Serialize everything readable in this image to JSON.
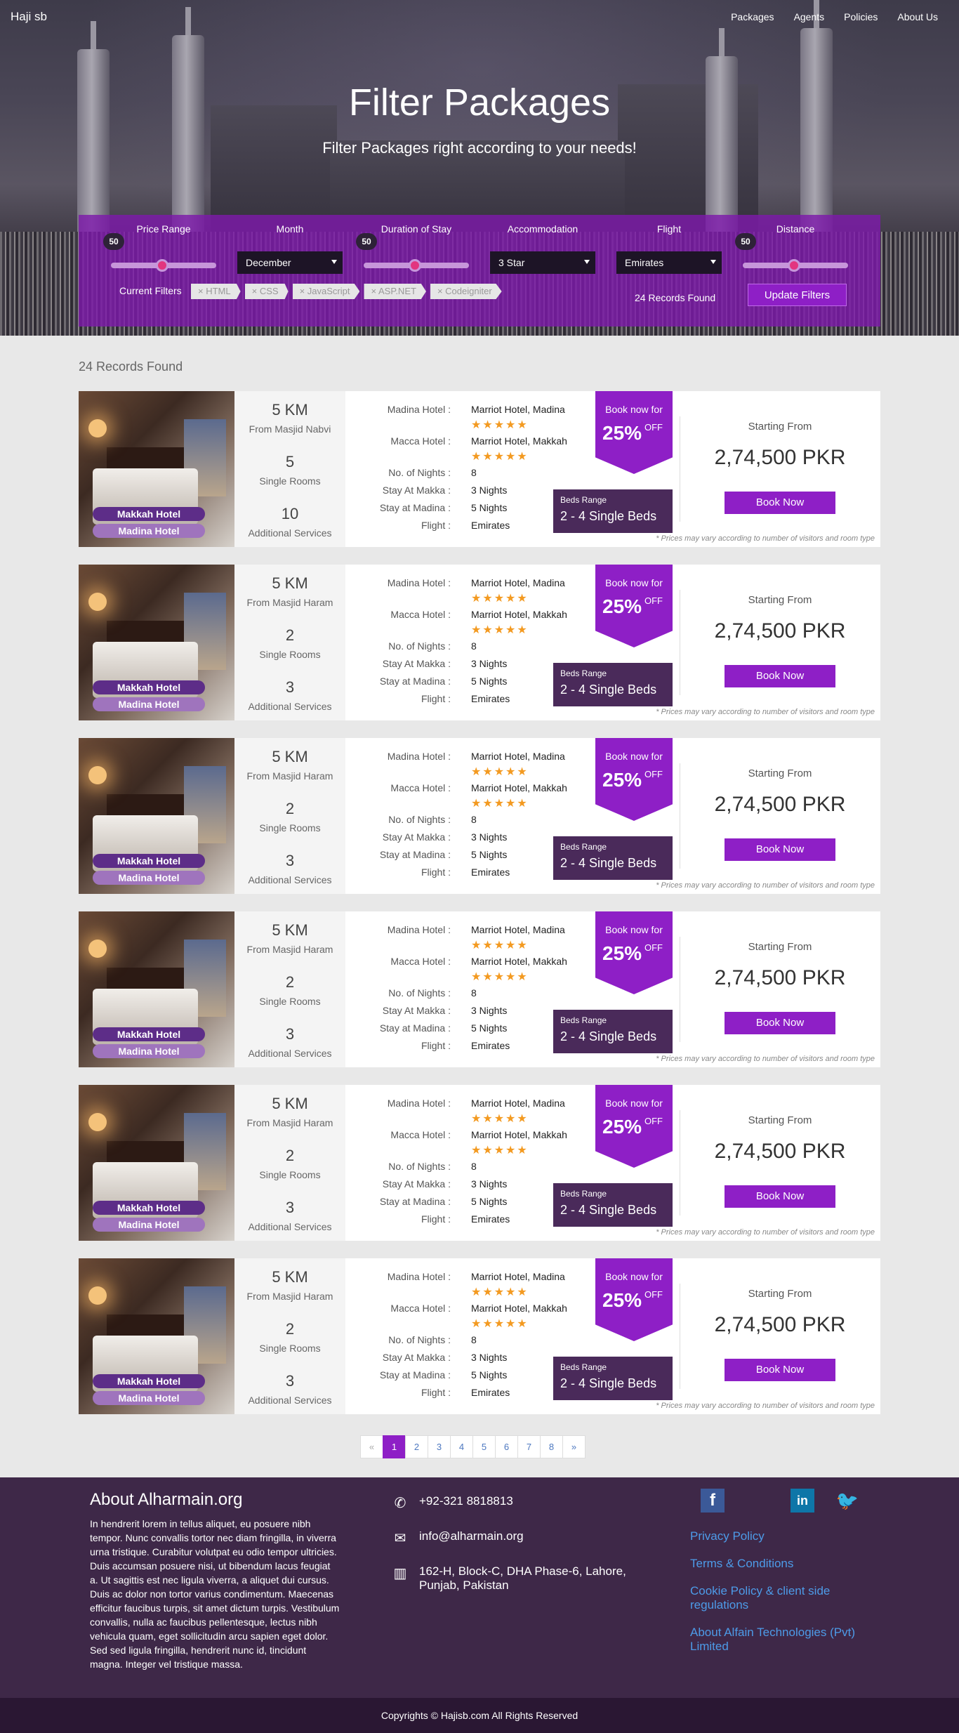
{
  "brand": "Haji sb",
  "nav": [
    "Packages",
    "Agents",
    "Policies",
    "About Us"
  ],
  "hero": {
    "title": "Filter Packages",
    "subtitle": "Filter Packages right according to your needs!"
  },
  "filters": {
    "labels": [
      "Price Range",
      "Month",
      "Duration of Stay",
      "Accommodation",
      "Flight",
      "Distance"
    ],
    "price_value": "50",
    "duration_value": "50",
    "distance_value": "50",
    "month": "December",
    "accommodation": "3 Star",
    "flight": "Emirates",
    "current_filters_label": "Current Filters",
    "tags": [
      "HTML",
      "CSS",
      "JavaScript",
      "ASP.NET",
      "Codeigniter"
    ],
    "records_found": "24 Records Found",
    "update_button": "Update Filters"
  },
  "records_heading": "24 Records Found",
  "card_labels": {
    "madina_hotel": "Madina Hotel :",
    "macca_hotel": "Macca Hotel :",
    "nights": "No. of Nights :",
    "stay_makka": "Stay At Makka :",
    "stay_madina": "Stay at Madina :",
    "flight": "Flight :",
    "book_now_for": "Book now for",
    "off": "OFF",
    "beds_range": "Beds Range",
    "starting_from": "Starting From",
    "book_button": "Book Now",
    "note": "* Prices may vary according to number of visitors and room type",
    "makkah_badge": "Makkah Hotel",
    "madina_badge": "Madina Hotel",
    "stars": "★★★★★"
  },
  "packages": [
    {
      "distance": "5 KM",
      "from": "From Masjid Nabvi",
      "rooms": "5",
      "rooms_label": "Single Rooms",
      "services": "10",
      "services_label": "Additional Services",
      "madina_hotel": "Marriot Hotel, Madina",
      "macca_hotel": "Marriot Hotel, Makkah",
      "nights": "8",
      "stay_makka": "3 Nights",
      "stay_madina": "5 Nights",
      "flight": "Emirates",
      "discount": "25%",
      "beds": "2 - 4 Single Beds",
      "price": "2,74,500 PKR"
    },
    {
      "distance": "5 KM",
      "from": "From Masjid Haram",
      "rooms": "2",
      "rooms_label": "Single Rooms",
      "services": "3",
      "services_label": "Additional Services",
      "madina_hotel": "Marriot Hotel, Madina",
      "macca_hotel": "Marriot Hotel, Makkah",
      "nights": "8",
      "stay_makka": "3 Nights",
      "stay_madina": "5 Nights",
      "flight": "Emirates",
      "discount": "25%",
      "beds": "2 - 4 Single Beds",
      "price": "2,74,500 PKR"
    },
    {
      "distance": "5 KM",
      "from": "From Masjid Haram",
      "rooms": "2",
      "rooms_label": "Single Rooms",
      "services": "3",
      "services_label": "Additional Services",
      "madina_hotel": "Marriot Hotel, Madina",
      "macca_hotel": "Marriot Hotel, Makkah",
      "nights": "8",
      "stay_makka": "3 Nights",
      "stay_madina": "5 Nights",
      "flight": "Emirates",
      "discount": "25%",
      "beds": "2 - 4 Single Beds",
      "price": "2,74,500 PKR"
    },
    {
      "distance": "5 KM",
      "from": "From Masjid Haram",
      "rooms": "2",
      "rooms_label": "Single Rooms",
      "services": "3",
      "services_label": "Additional Services",
      "madina_hotel": "Marriot Hotel, Madina",
      "macca_hotel": "Marriot Hotel, Makkah",
      "nights": "8",
      "stay_makka": "3 Nights",
      "stay_madina": "5 Nights",
      "flight": "Emirates",
      "discount": "25%",
      "beds": "2 - 4 Single Beds",
      "price": "2,74,500 PKR"
    },
    {
      "distance": "5 KM",
      "from": "From Masjid Haram",
      "rooms": "2",
      "rooms_label": "Single Rooms",
      "services": "3",
      "services_label": "Additional Services",
      "madina_hotel": "Marriot Hotel, Madina",
      "macca_hotel": "Marriot Hotel, Makkah",
      "nights": "8",
      "stay_makka": "3 Nights",
      "stay_madina": "5 Nights",
      "flight": "Emirates",
      "discount": "25%",
      "beds": "2 - 4 Single Beds",
      "price": "2,74,500 PKR"
    },
    {
      "distance": "5 KM",
      "from": "From Masjid Haram",
      "rooms": "2",
      "rooms_label": "Single Rooms",
      "services": "3",
      "services_label": "Additional Services",
      "madina_hotel": "Marriot Hotel, Madina",
      "macca_hotel": "Marriot Hotel, Makkah",
      "nights": "8",
      "stay_makka": "3 Nights",
      "stay_madina": "5 Nights",
      "flight": "Emirates",
      "discount": "25%",
      "beds": "2 - 4 Single Beds",
      "price": "2,74,500 PKR"
    }
  ],
  "pagination": {
    "prev": "«",
    "pages": [
      "1",
      "2",
      "3",
      "4",
      "5",
      "6",
      "7",
      "8"
    ],
    "next": "»",
    "active": "1"
  },
  "footer": {
    "about_title": "About Alharmain.org",
    "about_text": "In hendrerit lorem in tellus aliquet, eu posuere nibh tempor. Nunc convallis tortor nec diam fringilla, in viverra urna tristique. Curabitur volutpat eu odio tempor ultricies. Duis accumsan posuere nisi, ut bibendum lacus feugiat a. Ut sagittis est nec ligula viverra, a aliquet dui cursus. Duis ac dolor non tortor varius condimentum. Maecenas efficitur faucibus turpis, sit amet dictum turpis. Vestibulum convallis, nulla ac faucibus pellentesque, lectus nibh vehicula quam, eget sollicitudin arcu sapien eget dolor. Sed sed ligula fringilla, hendrerit nunc id, tincidunt magna. Integer vel tristique massa.",
    "phone": "+92-321 8818813",
    "email": "info@alharmain.org",
    "address": "162-H, Block-C, DHA Phase-6, Lahore, Punjab, Pakistan",
    "links": [
      "Privacy Policy",
      "Terms & Conditions",
      "Cookie Policy & client side regulations",
      "About Alfain Technologies (Pvt) Limited"
    ],
    "social": {
      "facebook": "f",
      "linkedin": "in",
      "twitter": "🐦"
    },
    "icons": {
      "phone": "phone-icon",
      "email": "envelope-icon",
      "address": "building-icon"
    },
    "copyright": "Copyrights © Hajisb.com All Rights Reserved"
  },
  "colors": {
    "accent": "#8e1fc6",
    "footer_bg": "#3e2848",
    "star": "#f39a21"
  }
}
